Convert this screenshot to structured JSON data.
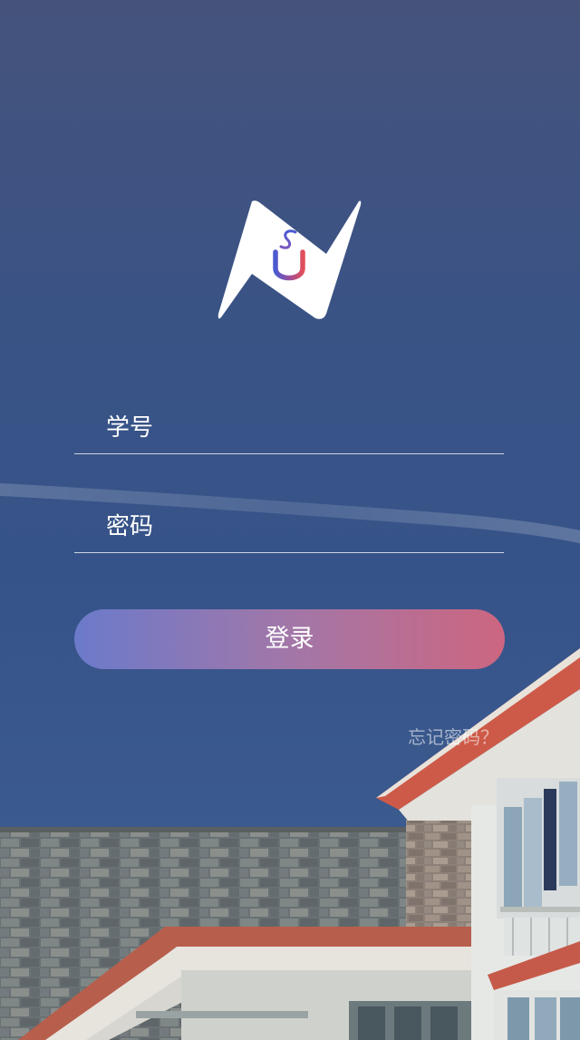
{
  "login_form": {
    "username_placeholder": "学号",
    "username_value": "",
    "password_placeholder": "密码",
    "password_value": "",
    "login_label": "登录",
    "forgot_password_label": "忘记密码？"
  },
  "logo": {
    "letters": "SU",
    "icon": "su-bolt-logo-icon"
  },
  "colors": {
    "button_gradient_start": "#6b7acb",
    "button_gradient_end": "#cd6680",
    "logo_accent_blue": "#4a5ad0",
    "logo_accent_red": "#e0505a"
  }
}
